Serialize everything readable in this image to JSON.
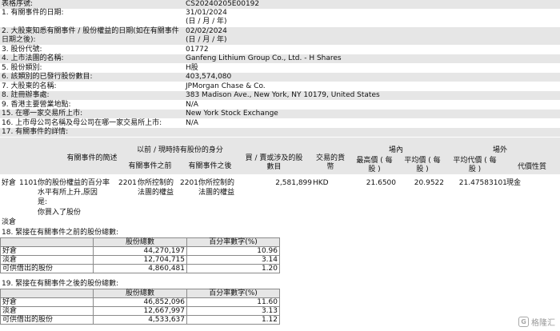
{
  "form": {
    "ref_label": "表格序號:",
    "ref_value": "CS20240205E00192",
    "items": [
      {
        "label": "1. 有關事件的日期:",
        "value": "31/01/2024",
        "sub": "(日 / 月 / 年)"
      },
      {
        "label": "2. 大股東知悉有關事件 / 股份權益的日期(如在有關事件",
        "label2": "日期之後):",
        "value": "02/02/2024",
        "sub": "(日 / 月 / 年)"
      },
      {
        "label": "3. 股份代號:",
        "value": "01772"
      },
      {
        "label": "4. 上市法團的名稱:",
        "value": "Ganfeng Lithium Group Co., Ltd. - H Shares"
      },
      {
        "label": "5. 股份類別:",
        "value": "H股"
      },
      {
        "label": "6. 該類別的已發行股份數目:",
        "value": "403,574,080"
      },
      {
        "label": "7. 大股東的名稱:",
        "value": "JPMorgan Chase & Co."
      },
      {
        "label": "8. 註冊辦事處:",
        "value": "383 Madison Ave., New York, NY 10179, United States"
      },
      {
        "label": "9. 香港主要營業地點:",
        "value": "N/A"
      },
      {
        "label": "15. 在哪一家交易所上市:",
        "value": "New York Stock Exchange"
      },
      {
        "label": "16. 上市母公司名稱及母公司在哪一家交易所上市:",
        "value": "N/A"
      }
    ],
    "details_title": "17. 有關事件的詳情:"
  },
  "event_table": {
    "headers": {
      "event": "有關事件的簡述",
      "group_cap": "以前 / 現時持有股份的身分",
      "before": "有關事件之前",
      "after": "有關事件之後",
      "shares_l1": "買 / 賣或涉及的股",
      "shares_l2": "數目",
      "currency_l1": "交易的貨",
      "currency_l2": "幣",
      "onex": "場內",
      "highest_l1": "最高價 ( 每",
      "highest_l2": "股 )",
      "avg_l1": "平均價 ( 每",
      "avg_l2": "股 )",
      "offex": "場外",
      "offavg_l1": "平均代價 ( 每",
      "offavg_l2": "股 )",
      "consid": "代價性質"
    },
    "row": {
      "position": "好倉",
      "event_code": "1101",
      "event_desc": [
        "你的股份權益的百分率",
        "水平有所上升,原因",
        "是:",
        "你買入了股份"
      ],
      "before_code": "2201",
      "before_desc": [
        "你所控制的",
        "法團的權益"
      ],
      "after_code": "2201",
      "after_desc": [
        "你所控制的",
        "法團的權益"
      ],
      "shares": "2,581,899",
      "currency": "HKD",
      "highest": "21.6500",
      "average": "20.9522",
      "off_average": "21.4758",
      "consid_code": "3101",
      "consid_desc": "現金"
    },
    "short_position": "淡倉"
  },
  "before_table": {
    "title": "18. 緊接在有關事件之前的股份總數:",
    "col_shares": "股份總數",
    "col_pct": "百分率數字(%)",
    "rows": [
      {
        "name": "好倉",
        "shares": "44,270,197",
        "pct": "10.96"
      },
      {
        "name": "淡倉",
        "shares": "12,704,715",
        "pct": "3.14"
      },
      {
        "name": "可供借出的股份",
        "shares": "4,860,481",
        "pct": "1.20"
      }
    ]
  },
  "after_table": {
    "title": "19. 緊接在有關事件之後的股份總數:",
    "col_shares": "股份總數",
    "col_pct": "百分率數字(%)",
    "rows": [
      {
        "name": "好倉",
        "shares": "46,852,096",
        "pct": "11.60"
      },
      {
        "name": "淡倉",
        "shares": "12,667,997",
        "pct": "3.13"
      },
      {
        "name": "可供借出的股份",
        "shares": "4,533,637",
        "pct": "1.12"
      }
    ]
  },
  "watermark": {
    "text": "格隆汇",
    "icon": "g-logo-icon"
  }
}
